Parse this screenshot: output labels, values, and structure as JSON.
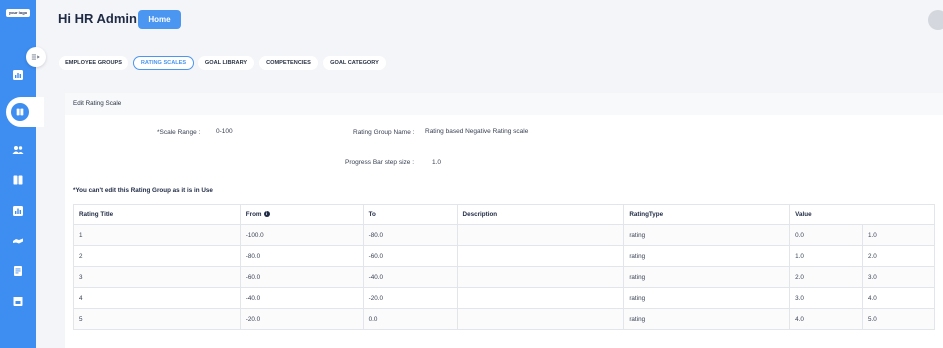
{
  "sidebar": {
    "logo_text": "your logo",
    "icons": [
      "dashboard-icon",
      "assignment-icon",
      "people-icon",
      "book-icon",
      "chart-icon",
      "handshake-icon",
      "notes-icon",
      "calendar-icon"
    ]
  },
  "header": {
    "greeting": "Hi HR Admin",
    "home_label": "Home"
  },
  "tabs": [
    {
      "label": "EMPLOYEE GROUPS"
    },
    {
      "label": "RATING SCALES"
    },
    {
      "label": "GOAL LIBRARY"
    },
    {
      "label": "COMPETENCIES"
    },
    {
      "label": "GOAL CATEGORY"
    }
  ],
  "panel": {
    "title": "Edit Rating Scale",
    "scale_range_label": "*Scale Range :",
    "scale_range_value": "0-100",
    "rating_group_label": "Rating Group Name :",
    "rating_group_value": "Rating based Negative Rating scale",
    "step_label": "Progress Bar step size :",
    "step_value": "1.0",
    "warning": "*You can't edit this Rating Group as it is in Use"
  },
  "table": {
    "headers": {
      "title": "Rating Title",
      "from": "From",
      "to": "To",
      "description": "Description",
      "type": "RatingType",
      "value": "Value"
    },
    "rows": [
      {
        "title": "1",
        "from": "-100.0",
        "to": "-80.0",
        "description": "",
        "type": "rating",
        "v1": "0.0",
        "v2": "1.0"
      },
      {
        "title": "2",
        "from": "-80.0",
        "to": "-60.0",
        "description": "",
        "type": "rating",
        "v1": "1.0",
        "v2": "2.0"
      },
      {
        "title": "3",
        "from": "-60.0",
        "to": "-40.0",
        "description": "",
        "type": "rating",
        "v1": "2.0",
        "v2": "3.0"
      },
      {
        "title": "4",
        "from": "-40.0",
        "to": "-20.0",
        "description": "",
        "type": "rating",
        "v1": "3.0",
        "v2": "4.0"
      },
      {
        "title": "5",
        "from": "-20.0",
        "to": "0.0",
        "description": "",
        "type": "rating",
        "v1": "4.0",
        "v2": "5.0"
      }
    ]
  },
  "colors": {
    "sidebar": "#3d8ef0",
    "accent": "#4a96f0",
    "text": "#1f2a44"
  }
}
